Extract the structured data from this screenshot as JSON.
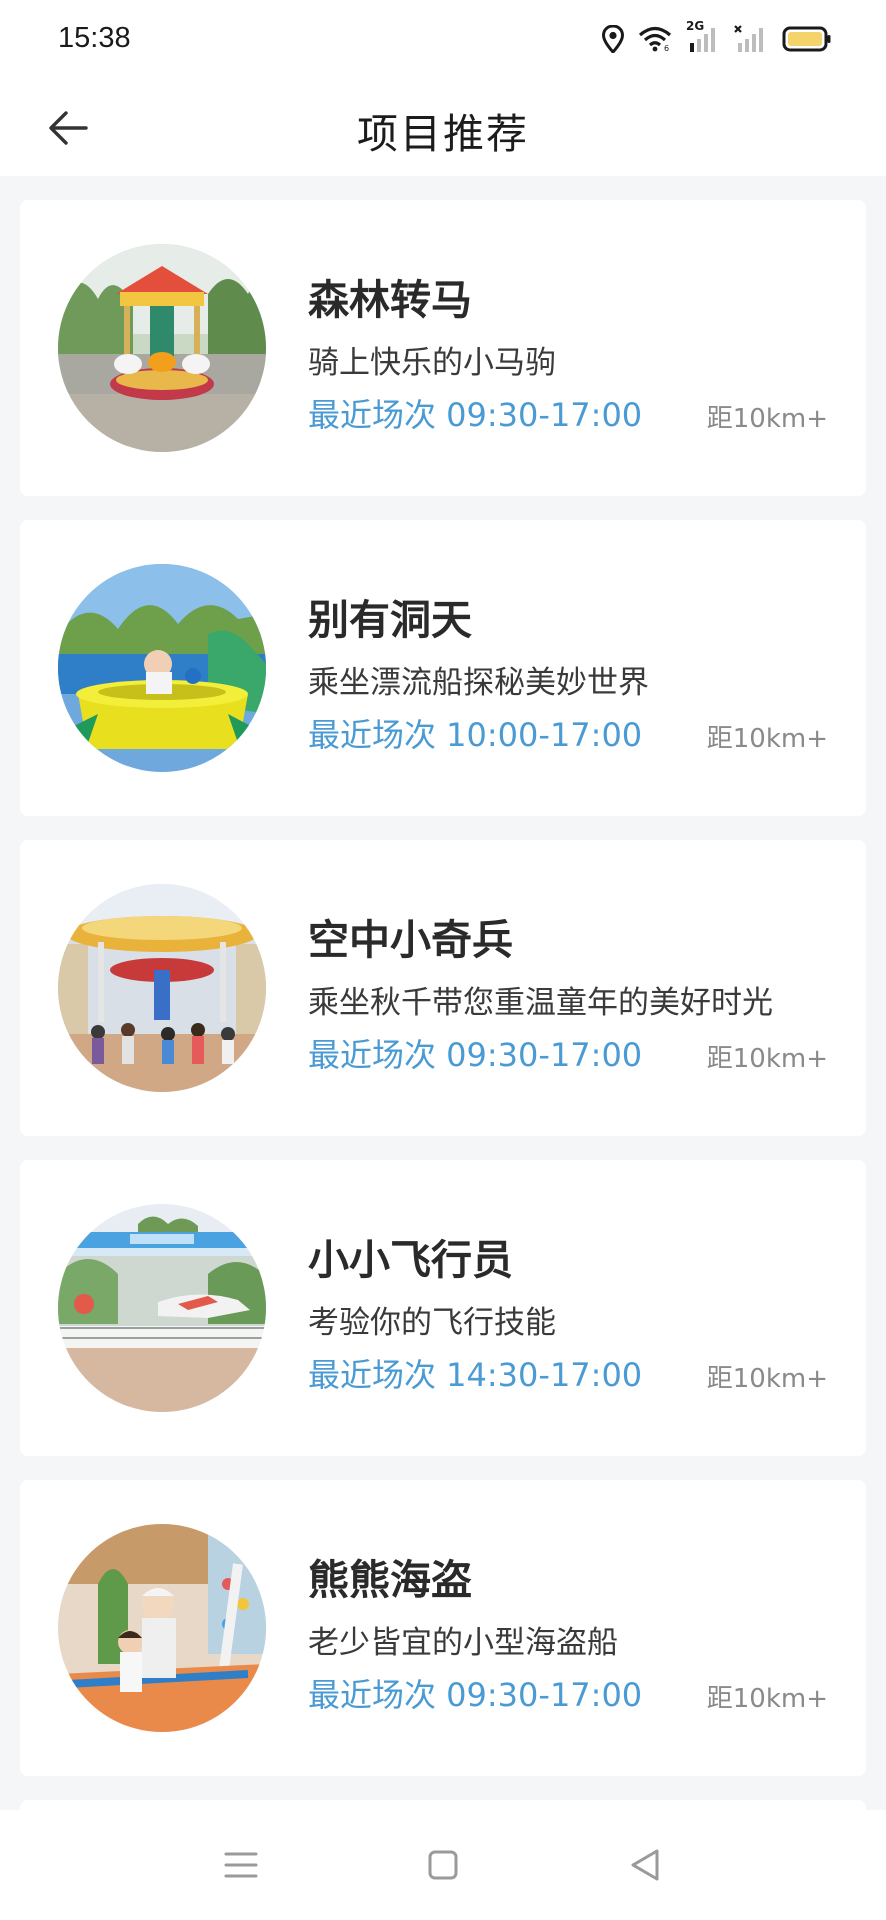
{
  "status_bar": {
    "time": "15:38",
    "icons": [
      "location-icon",
      "wifi-icon",
      "signal-2g-icon",
      "signal-no-service-icon",
      "battery-icon"
    ],
    "signal_label": "2G",
    "battery_color": "#f5d36b"
  },
  "header": {
    "title": "项目推荐",
    "back_icon": "back-arrow-icon"
  },
  "colors": {
    "accent": "#4a9ad4",
    "background": "#f5f6f8",
    "card": "#ffffff"
  },
  "projects": [
    {
      "name": "森林转马",
      "description": "骑上快乐的小马驹",
      "session": "最近场次 09:30-17:00",
      "distance": "距10km+",
      "image": "carousel-photo"
    },
    {
      "name": "别有洞天",
      "description": "乘坐漂流船探秘美妙世界",
      "session": "最近场次 10:00-17:00",
      "distance": "距10km+",
      "image": "boat-ride-photo"
    },
    {
      "name": "空中小奇兵",
      "description": "乘坐秋千带您重温童年的美好时光",
      "session": "最近场次 09:30-17:00",
      "distance": "距10km+",
      "image": "swing-ride-photo"
    },
    {
      "name": "小小飞行员",
      "description": "考验你的飞行技能",
      "session": "最近场次 14:30-17:00",
      "distance": "距10km+",
      "image": "plane-ride-photo"
    },
    {
      "name": "熊熊海盗",
      "description": "老少皆宜的小型海盗船",
      "session": "最近场次 09:30-17:00",
      "distance": "距10km+",
      "image": "pirate-ship-photo"
    }
  ],
  "nav_bar": {
    "buttons": [
      "menu-icon",
      "home-icon",
      "back-triangle-icon"
    ]
  }
}
